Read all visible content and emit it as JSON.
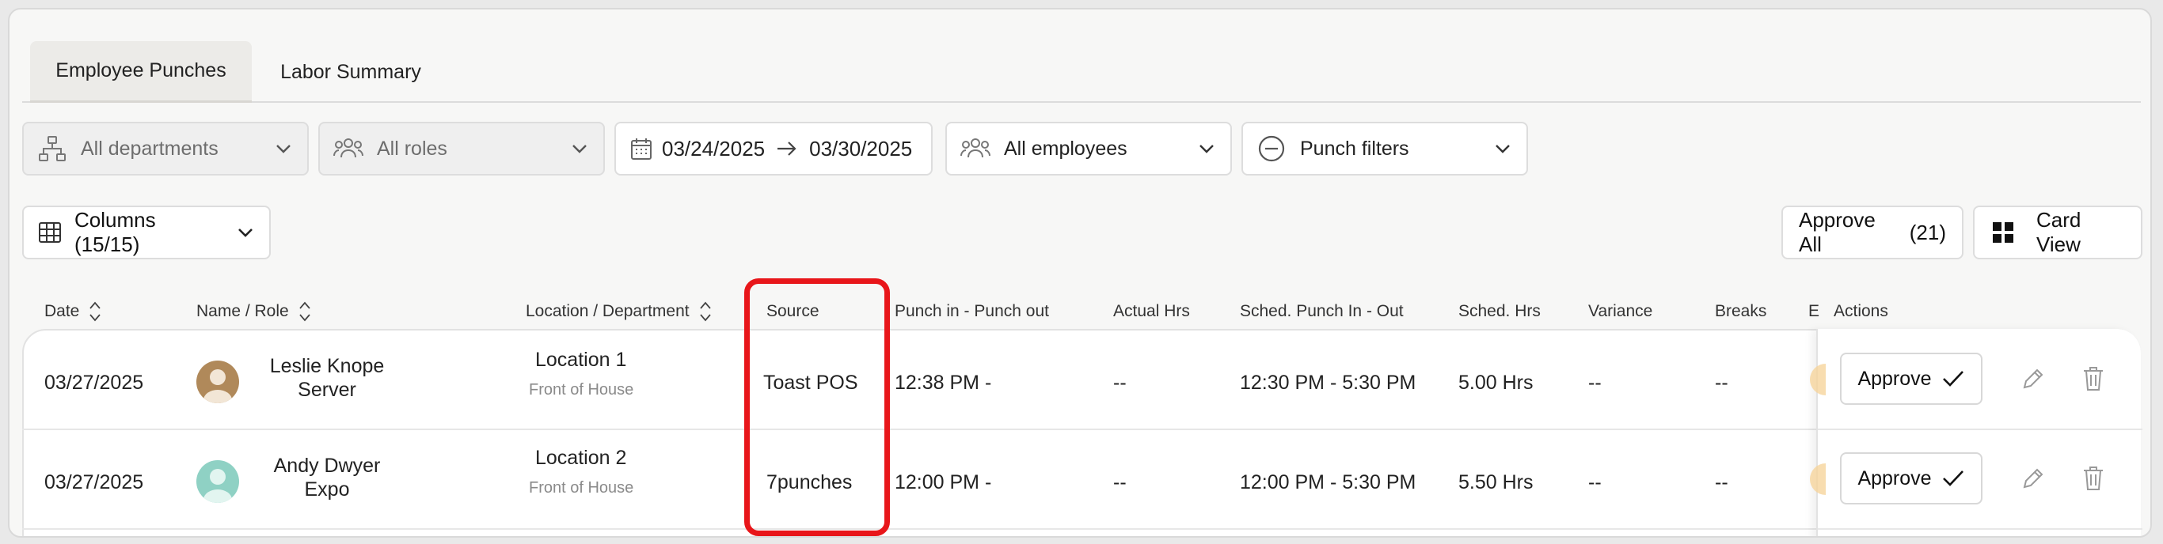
{
  "tabs": {
    "employee_punches": "Employee Punches",
    "labor_summary": "Labor Summary"
  },
  "filters": {
    "departments": "All departments",
    "roles": "All roles",
    "date_start": "03/24/2025",
    "date_end": "03/30/2025",
    "employees": "All employees",
    "punch_filters": "Punch filters"
  },
  "toolbar": {
    "columns": "Columns (15/15)",
    "approve_all": "Approve All",
    "approve_all_count": "(21)",
    "card_view": "Card View"
  },
  "table": {
    "headers": {
      "date": "Date",
      "name_role": "Name / Role",
      "location_department": "Location / Department",
      "source": "Source",
      "punch": "Punch in - Punch out",
      "actual_hrs": "Actual Hrs",
      "sched_punch": "Sched. Punch In - Out",
      "sched_hrs": "Sched. Hrs",
      "variance": "Variance",
      "breaks": "Breaks",
      "truncated": "E",
      "actions": "Actions"
    },
    "rows": [
      {
        "date": "03/27/2025",
        "name": "Leslie Knope",
        "role": "Server",
        "location": "Location 1",
        "department": "Front of House",
        "source": "Toast POS",
        "punch": "12:38 PM -",
        "actual_hrs": "--",
        "sched_punch": "12:30 PM - 5:30 PM",
        "sched_hrs": "5.00 Hrs",
        "variance": "--",
        "breaks": "--",
        "approve": "Approve",
        "avatar_color": "#b0895a"
      },
      {
        "date": "03/27/2025",
        "name": "Andy Dwyer",
        "role": "Expo",
        "location": "Location 2",
        "department": "Front of House",
        "source": "7punches",
        "punch": "12:00 PM -",
        "actual_hrs": "--",
        "sched_punch": "12:00 PM - 5:30 PM",
        "sched_hrs": "5.50 Hrs",
        "variance": "--",
        "breaks": "--",
        "approve": "Approve",
        "avatar_color": "#8fd1c4"
      }
    ]
  },
  "highlight_color": "#e8161a"
}
